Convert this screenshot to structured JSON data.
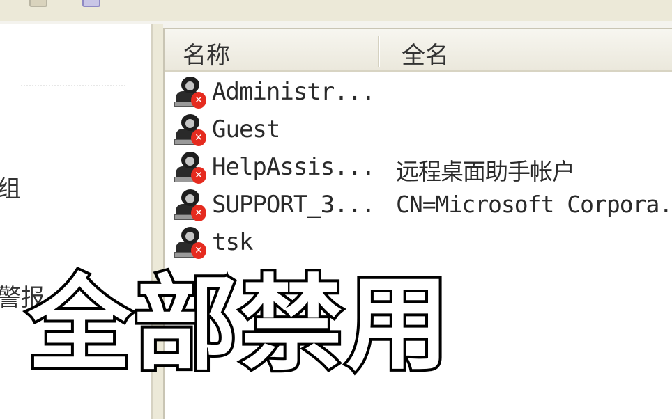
{
  "left_pane": {
    "frag_1": "组",
    "frag_2": "警报"
  },
  "list": {
    "columns": {
      "name": "名称",
      "full_name": "全名"
    },
    "rows": [
      {
        "name": "Administr...",
        "full_name": "",
        "icon": "disabled-user-icon"
      },
      {
        "name": "Guest",
        "full_name": "",
        "icon": "disabled-user-icon"
      },
      {
        "name": "HelpAssis...",
        "full_name": "远程桌面助手帐户",
        "icon": "disabled-user-icon"
      },
      {
        "name": "SUPPORT_3...",
        "full_name": "CN=Microsoft Corpora.",
        "icon": "disabled-user-icon"
      },
      {
        "name": "tsk",
        "full_name": "",
        "icon": "disabled-user-icon"
      }
    ]
  },
  "overlay": {
    "caption": "全部禁用"
  },
  "colors": {
    "disabled_badge": "#e52b1f",
    "window_bg": "#ece9d8"
  }
}
